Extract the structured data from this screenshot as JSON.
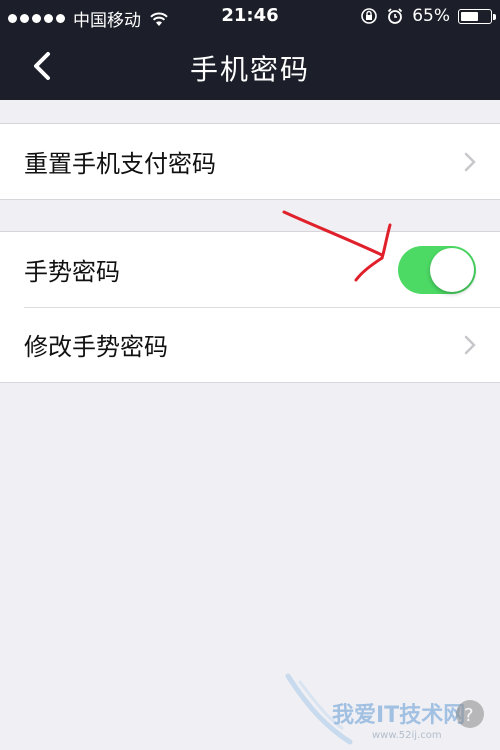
{
  "status_bar": {
    "carrier": "中国移动",
    "time": "21:46",
    "battery_percent": "65%",
    "battery_level": 0.65
  },
  "nav": {
    "title": "手机密码",
    "back_icon": "chevron-left-icon"
  },
  "groups": [
    {
      "rows": [
        {
          "label": "重置手机支付密码",
          "accessory": "chevron-right-icon"
        }
      ]
    },
    {
      "rows": [
        {
          "label": "手势密码",
          "accessory": "toggle",
          "toggle_on": true
        },
        {
          "label": "修改手势密码",
          "accessory": "chevron-right-icon"
        }
      ]
    }
  ],
  "colors": {
    "nav_background": "#1c1f29",
    "page_background": "#efeff4",
    "toggle_on": "#4cd964",
    "annotation_arrow": "#e0202a"
  },
  "watermark": {
    "text": "我爱IT技术网",
    "url": "www.52ij.com"
  }
}
